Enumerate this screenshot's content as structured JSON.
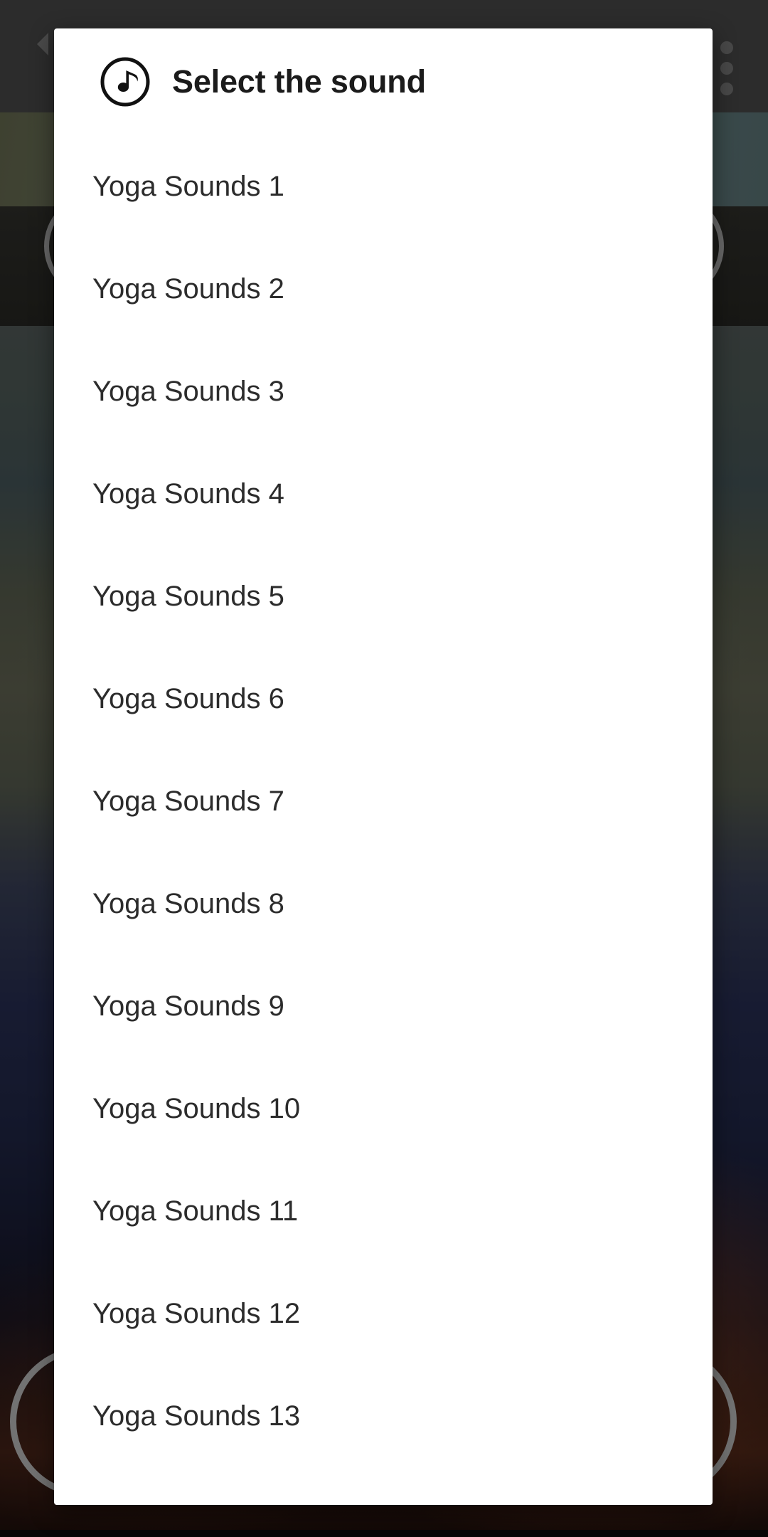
{
  "background_app": {
    "appbar": {
      "back_icon": "back-arrow-icon",
      "overflow_icon": "overflow-menu-icon",
      "background_color": "#424242"
    },
    "top_controls": [
      {
        "icon": "circle-button-left"
      },
      {
        "icon": "circle-button-right"
      }
    ],
    "bottom_controls": [
      {
        "icon": "list-menu-icon"
      },
      {
        "icon": "previous-icon"
      },
      {
        "icon": "play-icon"
      },
      {
        "icon": "next-icon"
      }
    ]
  },
  "dialog": {
    "icon": "music-note-icon",
    "title": "Select the sound",
    "items": [
      {
        "label": "Yoga Sounds 1"
      },
      {
        "label": "Yoga Sounds 2"
      },
      {
        "label": "Yoga Sounds 3"
      },
      {
        "label": "Yoga Sounds 4"
      },
      {
        "label": "Yoga Sounds 5"
      },
      {
        "label": "Yoga Sounds 6"
      },
      {
        "label": "Yoga Sounds 7"
      },
      {
        "label": "Yoga Sounds 8"
      },
      {
        "label": "Yoga Sounds 9"
      },
      {
        "label": "Yoga Sounds 10"
      },
      {
        "label": "Yoga Sounds 11"
      },
      {
        "label": "Yoga Sounds 12"
      },
      {
        "label": "Yoga Sounds 13"
      }
    ],
    "colors": {
      "surface": "#ffffff",
      "title_text": "#1b1b1b",
      "item_text": "#2c2c2c",
      "scrim": "rgba(0,0,0,0.32)"
    }
  }
}
